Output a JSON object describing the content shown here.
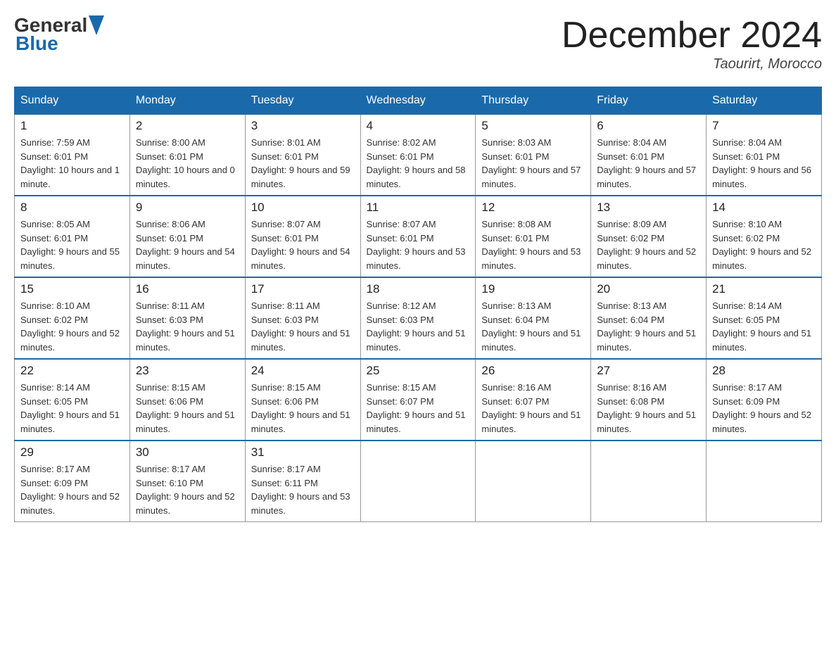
{
  "header": {
    "logo_text_general": "General",
    "logo_text_blue": "Blue",
    "month_title": "December 2024",
    "location": "Taourirt, Morocco"
  },
  "weekdays": [
    "Sunday",
    "Monday",
    "Tuesday",
    "Wednesday",
    "Thursday",
    "Friday",
    "Saturday"
  ],
  "weeks": [
    [
      {
        "day": "1",
        "sunrise": "7:59 AM",
        "sunset": "6:01 PM",
        "daylight": "10 hours and 1 minute."
      },
      {
        "day": "2",
        "sunrise": "8:00 AM",
        "sunset": "6:01 PM",
        "daylight": "10 hours and 0 minutes."
      },
      {
        "day": "3",
        "sunrise": "8:01 AM",
        "sunset": "6:01 PM",
        "daylight": "9 hours and 59 minutes."
      },
      {
        "day": "4",
        "sunrise": "8:02 AM",
        "sunset": "6:01 PM",
        "daylight": "9 hours and 58 minutes."
      },
      {
        "day": "5",
        "sunrise": "8:03 AM",
        "sunset": "6:01 PM",
        "daylight": "9 hours and 57 minutes."
      },
      {
        "day": "6",
        "sunrise": "8:04 AM",
        "sunset": "6:01 PM",
        "daylight": "9 hours and 57 minutes."
      },
      {
        "day": "7",
        "sunrise": "8:04 AM",
        "sunset": "6:01 PM",
        "daylight": "9 hours and 56 minutes."
      }
    ],
    [
      {
        "day": "8",
        "sunrise": "8:05 AM",
        "sunset": "6:01 PM",
        "daylight": "9 hours and 55 minutes."
      },
      {
        "day": "9",
        "sunrise": "8:06 AM",
        "sunset": "6:01 PM",
        "daylight": "9 hours and 54 minutes."
      },
      {
        "day": "10",
        "sunrise": "8:07 AM",
        "sunset": "6:01 PM",
        "daylight": "9 hours and 54 minutes."
      },
      {
        "day": "11",
        "sunrise": "8:07 AM",
        "sunset": "6:01 PM",
        "daylight": "9 hours and 53 minutes."
      },
      {
        "day": "12",
        "sunrise": "8:08 AM",
        "sunset": "6:01 PM",
        "daylight": "9 hours and 53 minutes."
      },
      {
        "day": "13",
        "sunrise": "8:09 AM",
        "sunset": "6:02 PM",
        "daylight": "9 hours and 52 minutes."
      },
      {
        "day": "14",
        "sunrise": "8:10 AM",
        "sunset": "6:02 PM",
        "daylight": "9 hours and 52 minutes."
      }
    ],
    [
      {
        "day": "15",
        "sunrise": "8:10 AM",
        "sunset": "6:02 PM",
        "daylight": "9 hours and 52 minutes."
      },
      {
        "day": "16",
        "sunrise": "8:11 AM",
        "sunset": "6:03 PM",
        "daylight": "9 hours and 51 minutes."
      },
      {
        "day": "17",
        "sunrise": "8:11 AM",
        "sunset": "6:03 PM",
        "daylight": "9 hours and 51 minutes."
      },
      {
        "day": "18",
        "sunrise": "8:12 AM",
        "sunset": "6:03 PM",
        "daylight": "9 hours and 51 minutes."
      },
      {
        "day": "19",
        "sunrise": "8:13 AM",
        "sunset": "6:04 PM",
        "daylight": "9 hours and 51 minutes."
      },
      {
        "day": "20",
        "sunrise": "8:13 AM",
        "sunset": "6:04 PM",
        "daylight": "9 hours and 51 minutes."
      },
      {
        "day": "21",
        "sunrise": "8:14 AM",
        "sunset": "6:05 PM",
        "daylight": "9 hours and 51 minutes."
      }
    ],
    [
      {
        "day": "22",
        "sunrise": "8:14 AM",
        "sunset": "6:05 PM",
        "daylight": "9 hours and 51 minutes."
      },
      {
        "day": "23",
        "sunrise": "8:15 AM",
        "sunset": "6:06 PM",
        "daylight": "9 hours and 51 minutes."
      },
      {
        "day": "24",
        "sunrise": "8:15 AM",
        "sunset": "6:06 PM",
        "daylight": "9 hours and 51 minutes."
      },
      {
        "day": "25",
        "sunrise": "8:15 AM",
        "sunset": "6:07 PM",
        "daylight": "9 hours and 51 minutes."
      },
      {
        "day": "26",
        "sunrise": "8:16 AM",
        "sunset": "6:07 PM",
        "daylight": "9 hours and 51 minutes."
      },
      {
        "day": "27",
        "sunrise": "8:16 AM",
        "sunset": "6:08 PM",
        "daylight": "9 hours and 51 minutes."
      },
      {
        "day": "28",
        "sunrise": "8:17 AM",
        "sunset": "6:09 PM",
        "daylight": "9 hours and 52 minutes."
      }
    ],
    [
      {
        "day": "29",
        "sunrise": "8:17 AM",
        "sunset": "6:09 PM",
        "daylight": "9 hours and 52 minutes."
      },
      {
        "day": "30",
        "sunrise": "8:17 AM",
        "sunset": "6:10 PM",
        "daylight": "9 hours and 52 minutes."
      },
      {
        "day": "31",
        "sunrise": "8:17 AM",
        "sunset": "6:11 PM",
        "daylight": "9 hours and 53 minutes."
      },
      null,
      null,
      null,
      null
    ]
  ]
}
